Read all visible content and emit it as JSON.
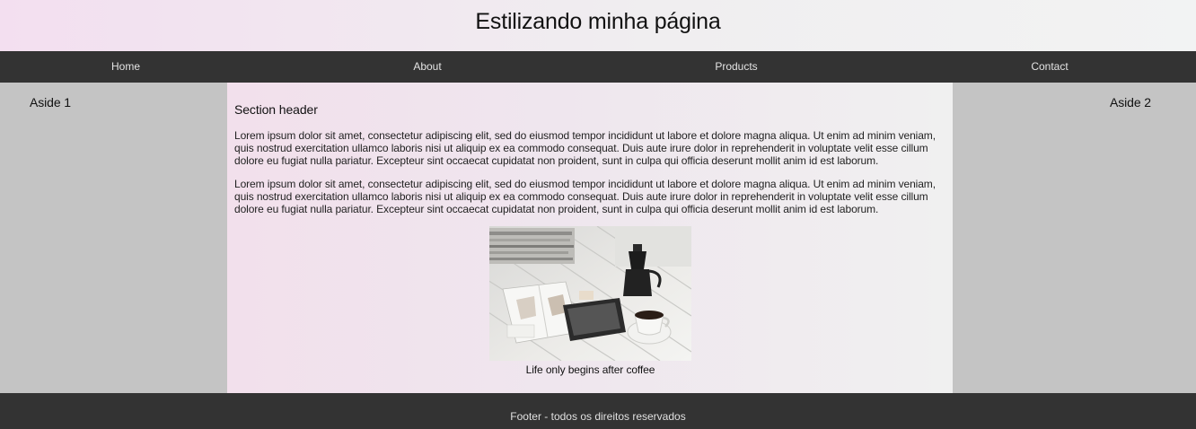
{
  "header": {
    "title": "Estilizando minha página"
  },
  "nav": {
    "items": [
      {
        "label": "Home"
      },
      {
        "label": "About"
      },
      {
        "label": "Products"
      },
      {
        "label": "Contact"
      }
    ]
  },
  "aside_left": {
    "title": "Aside 1"
  },
  "aside_right": {
    "title": "Aside 2"
  },
  "main": {
    "section_header": "Section header",
    "paragraphs": [
      "Lorem ipsum dolor sit amet, consectetur adipiscing elit, sed do eiusmod tempor incididunt ut labore et dolore magna aliqua. Ut enim ad minim veniam, quis nostrud exercitation ullamco laboris nisi ut aliquip ex ea commodo consequat. Duis aute irure dolor in reprehenderit in voluptate velit esse cillum dolore eu fugiat nulla pariatur. Excepteur sint occaecat cupidatat non proident, sunt in culpa qui officia deserunt mollit anim id est laborum.",
      "Lorem ipsum dolor sit amet, consectetur adipiscing elit, sed do eiusmod tempor incididunt ut labore et dolore magna aliqua. Ut enim ad minim veniam, quis nostrud exercitation ullamco laboris nisi ut aliquip ex ea commodo consequat. Duis aute irure dolor in reprehenderit in voluptate velit esse cillum dolore eu fugiat nulla pariatur. Excepteur sint occaecat cupidatat non proident, sunt in culpa qui officia deserunt mollit anim id est laborum."
    ],
    "figure_caption": "Life only begins after coffee"
  },
  "footer": {
    "text": "Footer - todos os direitos reservados"
  },
  "colors": {
    "nav_background": "#333333",
    "aside_background": "#c4c4c4",
    "header_gradient_start": "#f3dff0",
    "header_gradient_end": "#f2f3f3"
  }
}
